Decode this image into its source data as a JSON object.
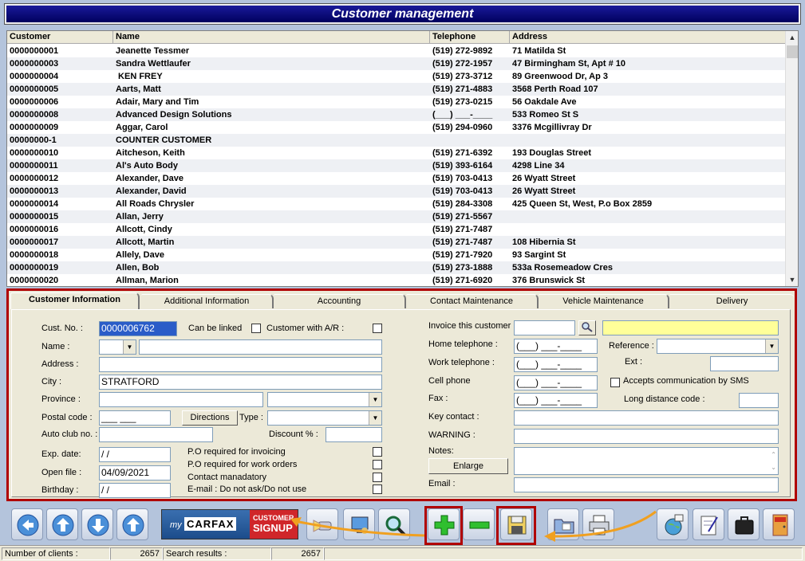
{
  "window": {
    "title": "Customer management"
  },
  "grid": {
    "columns": [
      "Customer",
      "Name",
      "Telephone",
      "Address"
    ],
    "rows": [
      [
        "0000000001",
        "Jeanette Tessmer",
        "(519) 272-9892",
        "71 Matilda St"
      ],
      [
        "0000000003",
        "Sandra Wettlaufer",
        "(519) 272-1957",
        "47 Birmingham St, Apt # 10"
      ],
      [
        "0000000004",
        " KEN FREY",
        "(519) 273-3712",
        "89 Greenwood Dr, Ap 3"
      ],
      [
        "0000000005",
        "Aarts, Matt",
        "(519) 271-4883",
        "3568 Perth Road 107"
      ],
      [
        "0000000006",
        "Adair, Mary and Tim",
        "(519) 273-0215",
        "56 Oakdale Ave"
      ],
      [
        "0000000008",
        "Advanced Design Solutions",
        "(___) ___-____",
        "533 Romeo St S"
      ],
      [
        "0000000009",
        "Aggar, Carol",
        "(519) 294-0960",
        "3376 Mcgillivray Dr"
      ],
      [
        "00000000-1",
        "COUNTER CUSTOMER",
        "",
        ""
      ],
      [
        "0000000010",
        "Aitcheson, Keith",
        "(519) 271-6392",
        "193 Douglas Street"
      ],
      [
        "0000000011",
        "Al's Auto Body",
        "(519) 393-6164",
        "4298 Line 34"
      ],
      [
        "0000000012",
        "Alexander, Dave",
        "(519) 703-0413",
        "26 Wyatt Street"
      ],
      [
        "0000000013",
        "Alexander, David",
        "(519) 703-0413",
        "26 Wyatt Street"
      ],
      [
        "0000000014",
        "All Roads Chrysler",
        "(519) 284-3308",
        "425 Queen St, West, P.o Box 2859"
      ],
      [
        "0000000015",
        "Allan, Jerry",
        "(519) 271-5567",
        ""
      ],
      [
        "0000000016",
        "Allcott, Cindy",
        "(519) 271-7487",
        ""
      ],
      [
        "0000000017",
        "Allcott, Martin",
        "(519) 271-7487",
        "108 Hibernia St"
      ],
      [
        "0000000018",
        "Allely, Dave",
        "(519) 271-7920",
        "93 Sargint St"
      ],
      [
        "0000000019",
        "Allen, Bob",
        "(519) 273-1888",
        "533a Rosemeadow Cres"
      ],
      [
        "0000000020",
        "Allman, Marion",
        "(519) 271-6920",
        "376 Brunswick St"
      ]
    ]
  },
  "tabs": [
    "Customer Information",
    "Additional Information",
    "Accounting",
    "Contact Maintenance",
    "Vehicle Maintenance",
    "Delivery"
  ],
  "form": {
    "cust_no_label": "Cust. No. :",
    "cust_no_value": "0000006762",
    "can_be_linked": "Can be linked",
    "customer_ar": "Customer with A/R :",
    "name_label": "Name :",
    "address_label": "Address :",
    "city_label": "City :",
    "city_value": "STRATFORD",
    "province_label": "Province :",
    "postal_label": "Postal code :",
    "postal_value": "___ ___",
    "directions": "Directions",
    "type_label": "Type :",
    "auto_club_label": "Auto club no. :",
    "discount_label": "Discount % :",
    "exp_label": "Exp. date:",
    "exp_value": " /  /",
    "open_label": "Open file :",
    "open_value": "04/09/2021",
    "birthday_label": "Birthday :",
    "birthday_value": " /  /",
    "po_invoicing": "P.O required for invoicing",
    "po_work": "P.O required for work orders",
    "contact_mandatory": "Contact manadatory",
    "email_no_ask": "E-mail : Do not ask/Do not use",
    "invoice_label": "Invoice this customer",
    "home_label": "Home telephone :",
    "work_label": "Work telephone :",
    "cell_label": "Cell phone",
    "fax_label": "Fax :",
    "phone_mask": "(___) ___-____",
    "reference_label": "Reference :",
    "ext_label": "Ext :",
    "sms_label": "Accepts communication by SMS",
    "long_distance_label": "Long distance code :",
    "key_contact_label": "Key contact :",
    "warning_label": "WARNING :",
    "notes_label": "Notes:",
    "enlarge": "Enlarge",
    "email_label": "Email :"
  },
  "toolbar": {
    "carfax_prefix": "my",
    "carfax_brand": "CARFAX",
    "carfax_signup_line1": "CUSTOMER",
    "carfax_signup_line2": "SIGNUP"
  },
  "status": {
    "clients_label": "Number of clients :",
    "clients_value": "2657",
    "search_label": "Search results :",
    "search_value": "2657"
  },
  "colors": {
    "highlight_red": "#b00000",
    "arrow_orange": "#f0a020",
    "title_blue": "#0a0a80",
    "invoice_yellow": "#ffff99"
  }
}
